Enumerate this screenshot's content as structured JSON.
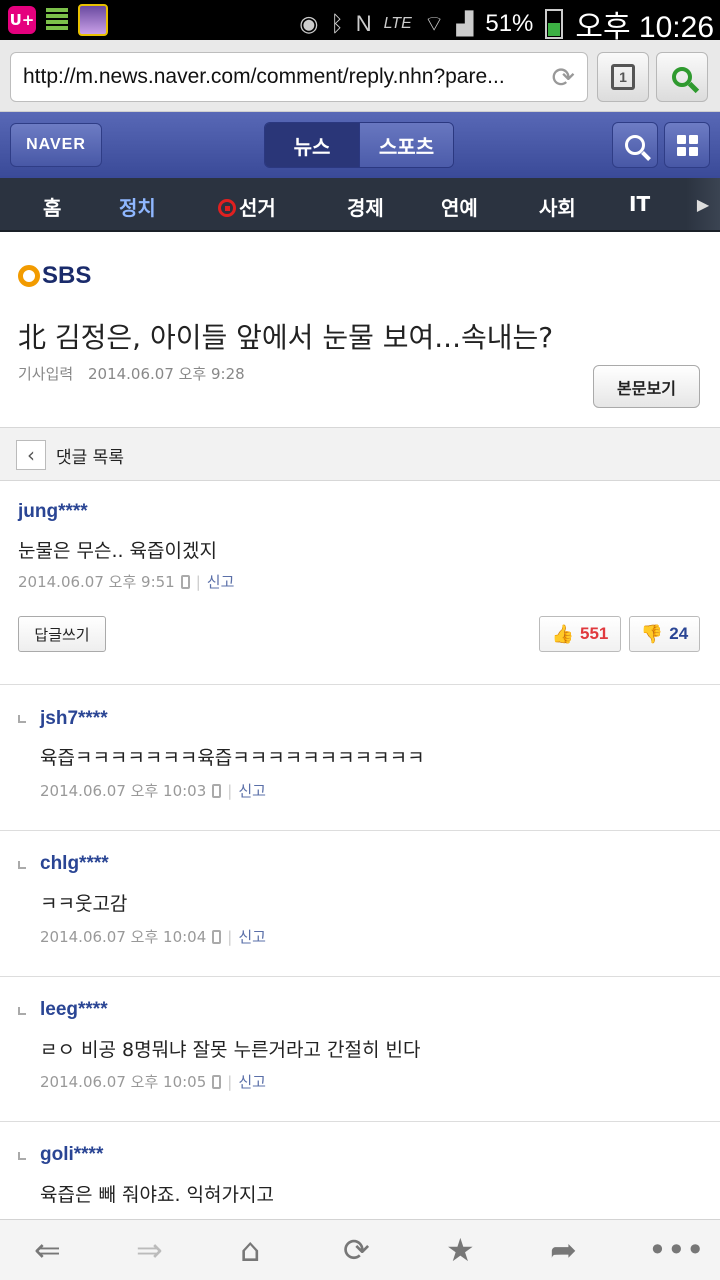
{
  "status_bar": {
    "carrier_icon": "U+",
    "network": "LTE",
    "battery": "51%",
    "time": "오후 10:26"
  },
  "browser": {
    "url": "http://m.news.naver.com/comment/reply.nhn?pare...",
    "tab_count": "1"
  },
  "naver": {
    "logo": "NAVER",
    "segments": [
      "뉴스",
      "스포츠"
    ],
    "active_segment": "뉴스"
  },
  "categories": [
    {
      "label": "홈"
    },
    {
      "label": "정치"
    },
    {
      "label": "선거"
    },
    {
      "label": "경제"
    },
    {
      "label": "연예"
    },
    {
      "label": "사회"
    },
    {
      "label": "IT"
    }
  ],
  "active_category": "정치",
  "article": {
    "source": "SBS",
    "title": "北 김정은, 아이들 앞에서 눈물 보여...속내는?",
    "date_label": "기사입력",
    "date": "2014.06.07 오후 9:28",
    "view_article": "본문보기"
  },
  "comment_list_title": "댓글 목록",
  "main_comment": {
    "user": "jung****",
    "text": "눈물은 무슨.. 육즙이겠지",
    "time": "2014.06.07 오후 9:51",
    "report": "신고",
    "reply_button": "답글쓰기",
    "likes": "551",
    "dislikes": "24"
  },
  "replies": [
    {
      "user": "jsh7****",
      "text": "육즙ㅋㅋㅋㅋㅋㅋㅋ육즙ㅋㅋㅋㅋㅋㅋㅋㅋㅋㅋㅋ",
      "time": "2014.06.07 오후 10:03",
      "report": "신고"
    },
    {
      "user": "chlg****",
      "text": "ㅋㅋ웃고감",
      "time": "2014.06.07 오후 10:04",
      "report": "신고"
    },
    {
      "user": "leeg****",
      "text": "ㄹㅇ 비공 8명뭐냐 잘못 누른거라고 간절히 빈다",
      "time": "2014.06.07 오후 10:05",
      "report": "신고"
    },
    {
      "user": "goli****",
      "text": "육즙은 빼 줘야죠. 익혀가지고",
      "time": "",
      "report": ""
    }
  ],
  "bottom_nav": [
    "back-arrow-icon",
    "forward-arrow-icon",
    "home-icon",
    "refresh-icon",
    "star-icon",
    "share-icon",
    "more-icon"
  ]
}
